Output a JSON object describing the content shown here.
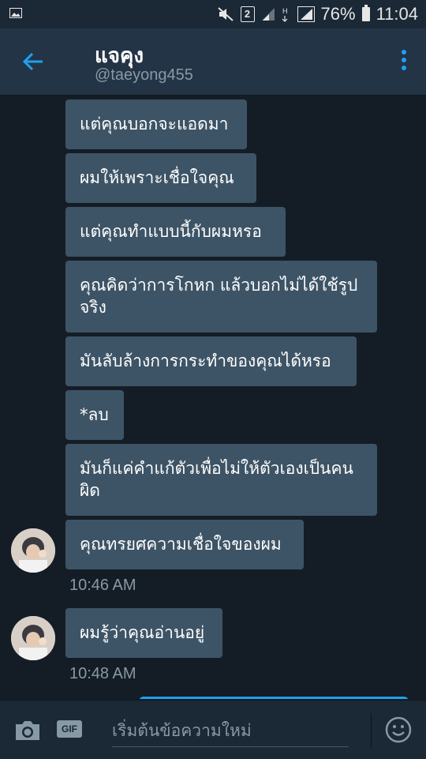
{
  "status_bar": {
    "battery_percent": "76%",
    "time": "11:04",
    "sim_badge": "2",
    "icons": [
      "image-icon",
      "mute-icon",
      "signal-icon",
      "hplus-icon",
      "signal-full-icon",
      "battery-icon"
    ]
  },
  "header": {
    "title": "แจคุง",
    "handle": "@taeyong455"
  },
  "messages": [
    {
      "text": "แต่คุณบอกจะแอดมา"
    },
    {
      "text": "ผมให้เพราะเชื่อใจคุณ"
    },
    {
      "text": "แต่คุณทำแบบนี้กับผมหรอ"
    },
    {
      "text": "คุณคิดว่าการโกหก แล้วบอกไม่ได้ใช้รูปจริง"
    },
    {
      "text": "มันลับล้างการกระทำของคุณได้หรอ"
    },
    {
      "text": "*ลบ"
    },
    {
      "text": "มันก็แค่คำแก้ตัวเพื่อไม่ให้ตัวเองเป็นคนผิด"
    },
    {
      "text": "คุณทรยศความเชื่อใจของผม"
    },
    {
      "text": "ผมรู้ว่าคุณอ่านอยู่"
    }
  ],
  "timestamps": [
    "10:46 AM",
    "10:48 AM"
  ],
  "composer": {
    "placeholder": "เริ่มต้นข้อความใหม่",
    "gif_label": "GIF"
  },
  "colors": {
    "background": "#141d26",
    "bar": "#243447",
    "bubble": "#3d5466",
    "accent": "#1da1f2",
    "muted": "#8899a6"
  }
}
